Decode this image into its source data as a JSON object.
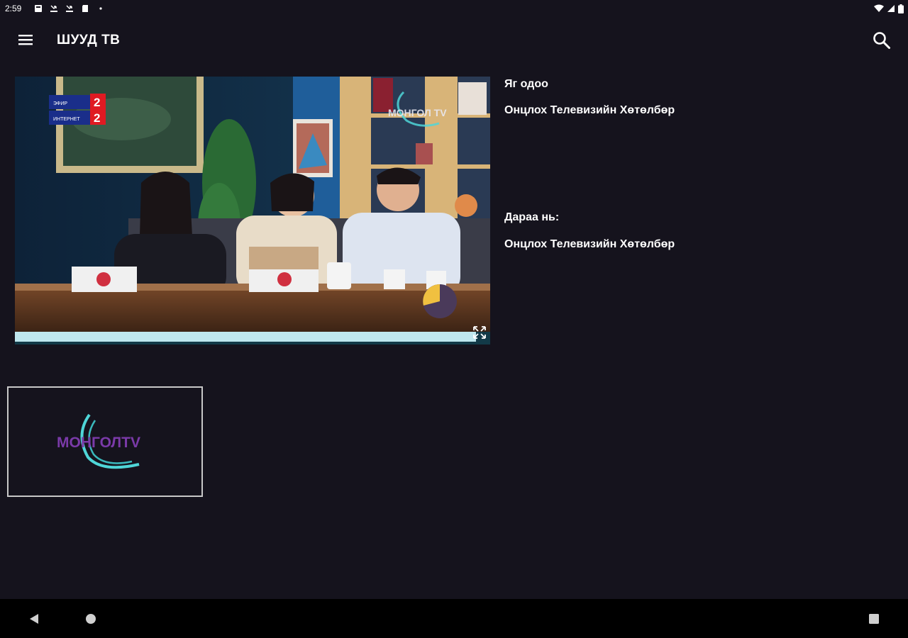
{
  "status_bar": {
    "time": "2:59",
    "icons_left": [
      "notification-icon",
      "missed-call-icon",
      "missed-call-icon",
      "sd-card-icon",
      "dot-icon"
    ],
    "icons_right": [
      "wifi-icon",
      "signal-icon",
      "battery-icon"
    ]
  },
  "app_bar": {
    "title": "ШУУД ТВ",
    "menu_icon": "hamburger-menu-icon",
    "search_icon": "search-icon"
  },
  "video": {
    "channel_watermark": "МОНГОЛ TV",
    "badge_top": "2",
    "badge_bottom": "2",
    "badge_label_top": "ЭФИР",
    "badge_label_bottom": "ИНТЕРНЕТ",
    "fullscreen_icon": "fullscreen-icon"
  },
  "program_info": {
    "now_label": "Яг одоо",
    "now_title": "Онцлох Телевизийн Хөтөлбөр",
    "next_label": "Дараа нь:",
    "next_title": "Онцлох Телевизийн Хөтөлбөр"
  },
  "channel_tile": {
    "logo_text": "МОНГОЛTV"
  },
  "colors": {
    "background": "#15131d",
    "nav_bar": "#000000",
    "logo_purple": "#7a3aa8",
    "logo_cyan": "#4fd6d8",
    "loader_yellow": "#f0c040",
    "loader_dark": "#4a3a5a"
  },
  "nav_bar": {
    "back_icon": "back-icon",
    "home_icon": "home-icon",
    "recents_icon": "recents-icon"
  }
}
